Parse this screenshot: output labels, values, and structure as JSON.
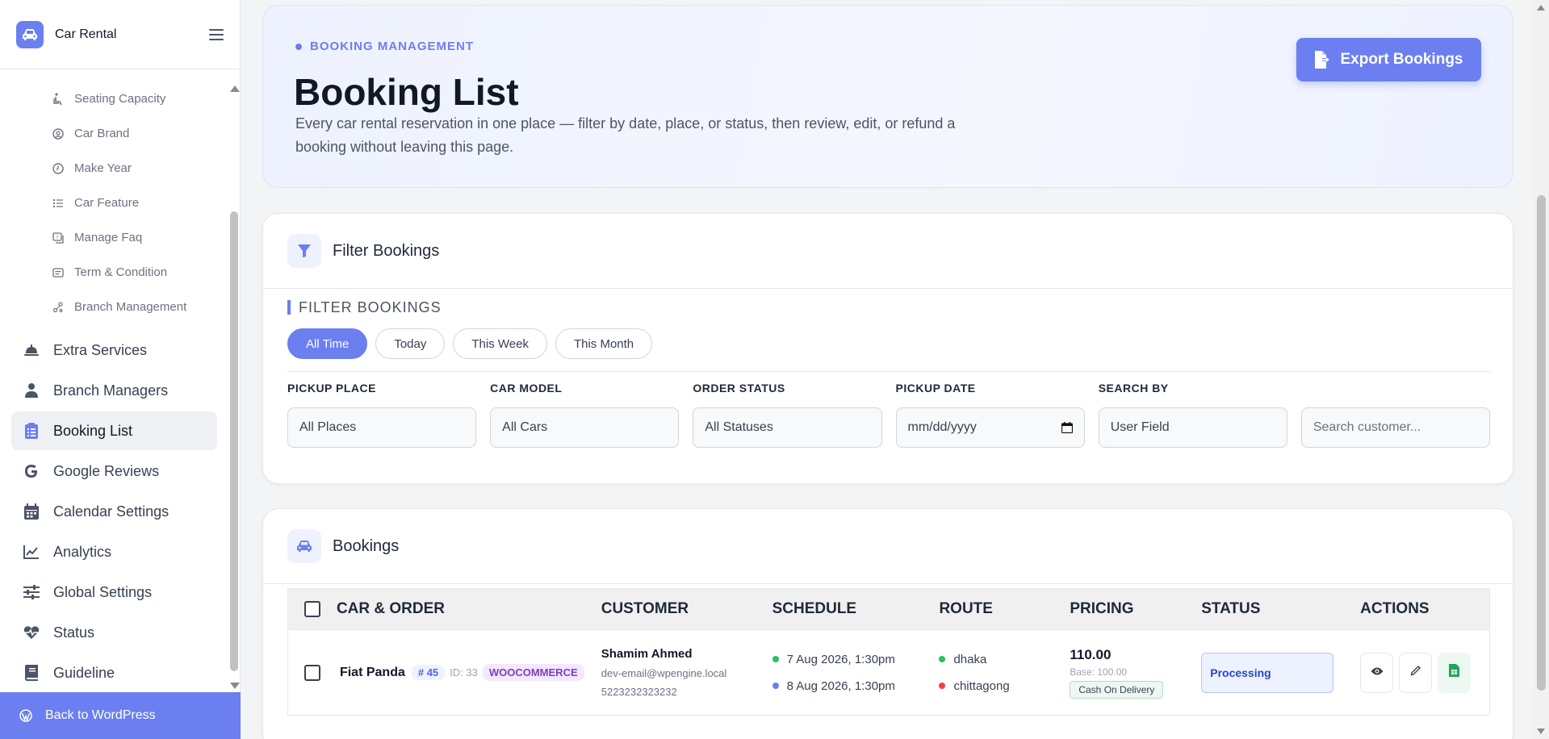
{
  "brand": {
    "name": "Car Rental"
  },
  "sidebar": {
    "sub_items": [
      {
        "label": "Seating Capacity",
        "icon": "seat-icon"
      },
      {
        "label": "Car Brand",
        "icon": "brand-icon"
      },
      {
        "label": "Make Year",
        "icon": "clock-icon"
      },
      {
        "label": "Car Feature",
        "icon": "list-icon"
      },
      {
        "label": "Manage Faq",
        "icon": "faq-icon"
      },
      {
        "label": "Term & Condition",
        "icon": "terms-icon"
      },
      {
        "label": "Branch Management",
        "icon": "branch-icon"
      }
    ],
    "items": [
      {
        "label": "Extra Services",
        "icon": "bell-icon"
      },
      {
        "label": "Branch Managers",
        "icon": "user-icon"
      },
      {
        "label": "Booking List",
        "icon": "clipboard-icon",
        "active": true
      },
      {
        "label": "Google Reviews",
        "icon": "google-icon"
      },
      {
        "label": "Calendar Settings",
        "icon": "calendar-icon"
      },
      {
        "label": "Analytics",
        "icon": "chart-line-icon"
      },
      {
        "label": "Global Settings",
        "icon": "sliders-icon"
      },
      {
        "label": "Status",
        "icon": "heartbeat-icon"
      },
      {
        "label": "Guideline",
        "icon": "book-icon"
      }
    ],
    "back_label": "Back to WordPress"
  },
  "hero": {
    "tag": "BOOKING MANAGEMENT",
    "title": "Booking List",
    "description": "Every car rental reservation in one place — filter by date, place, or status, then review, edit, or refund a booking without leaving this page.",
    "export_label": "Export Bookings"
  },
  "filter": {
    "card_title": "Filter Bookings",
    "section_label": "FILTER BOOKINGS",
    "pills": [
      "All Time",
      "Today",
      "This Week",
      "This Month"
    ],
    "active_pill": "All Time",
    "fields": {
      "pickup_place": {
        "label": "PICKUP PLACE",
        "value": "All Places"
      },
      "car_model": {
        "label": "CAR MODEL",
        "value": "All Cars"
      },
      "order_status": {
        "label": "ORDER STATUS",
        "value": "All Statuses"
      },
      "pickup_date": {
        "label": "PICKUP DATE",
        "value": "mm/dd/yyyy"
      },
      "search_by": {
        "label": "SEARCH BY",
        "value": "User Field"
      },
      "search": {
        "placeholder": "Search customer..."
      }
    }
  },
  "bookings": {
    "card_title": "Bookings",
    "columns": [
      "CAR & ORDER",
      "CUSTOMER",
      "SCHEDULE",
      "ROUTE",
      "PRICING",
      "STATUS",
      "ACTIONS"
    ],
    "rows": [
      {
        "car": "Fiat Panda",
        "order_no": "# 45",
        "id_text": "ID: 33",
        "source": "WOOCOMMERCE",
        "customer_name": "Shamim Ahmed",
        "customer_email": "dev-email@wpengine.local",
        "customer_phone": "5223232323232",
        "pickup_time": "7 Aug 2026, 1:30pm",
        "dropoff_time": "8 Aug 2026, 1:30pm",
        "route_from": "dhaka",
        "route_to": "chittagong",
        "price": "110.00",
        "base": "Base: 100.00",
        "payment": "Cash On Delivery",
        "status": "Processing"
      }
    ]
  },
  "colors": {
    "accent": "#6b7ff0",
    "pickup_dot": "#22c55e",
    "dropoff_dot": "#6b7ff0",
    "route_from_dot": "#22c55e",
    "route_to_dot": "#ef4444"
  }
}
